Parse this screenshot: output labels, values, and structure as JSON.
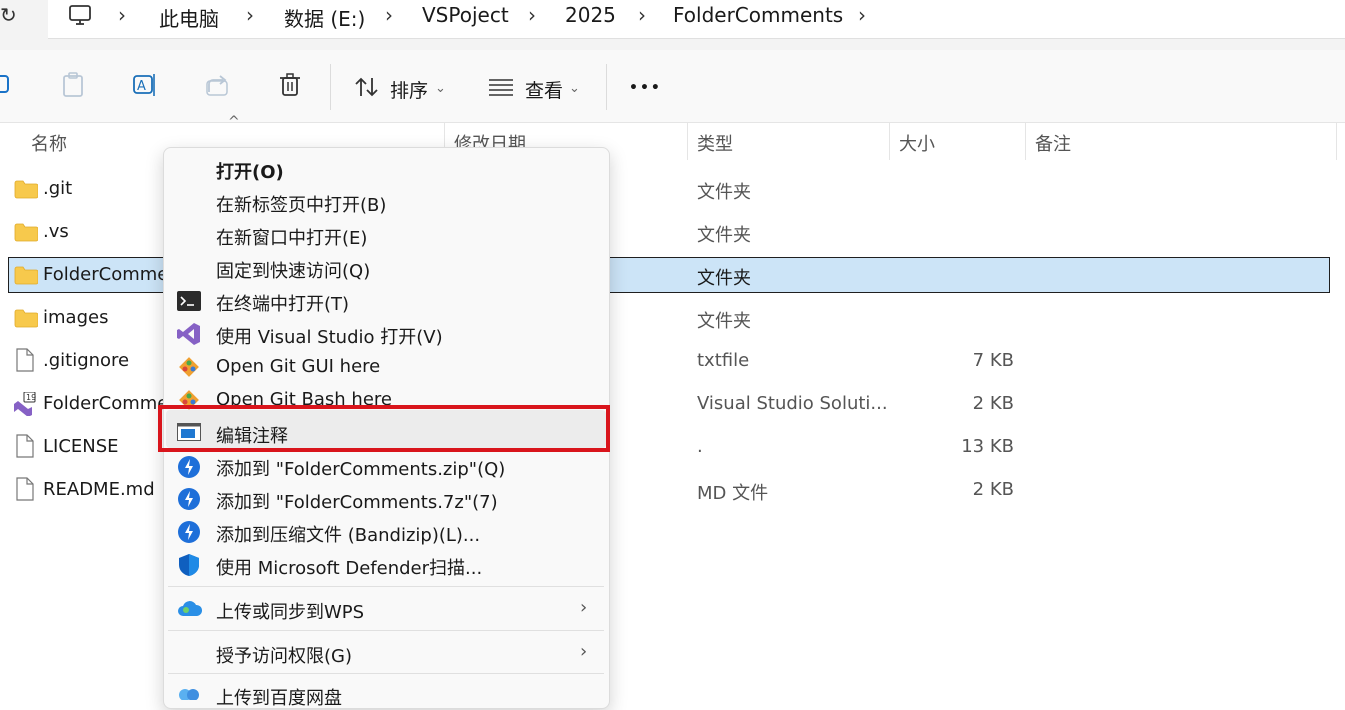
{
  "address": {
    "crumbs": [
      "此电脑",
      "数据 (E:)",
      "VSPoject",
      "2025",
      "FolderComments"
    ]
  },
  "toolbar": {
    "sort_label": "排序",
    "view_label": "查看",
    "more_label": "•••"
  },
  "columns": {
    "name": "名称",
    "date": "修改日期",
    "type": "类型",
    "size": "大小",
    "comment": "备注"
  },
  "files": [
    {
      "name": ".git",
      "type": "文件夹",
      "size": "",
      "icon": "folder-icon"
    },
    {
      "name": ".vs",
      "type": "文件夹",
      "size": "",
      "icon": "folder-icon"
    },
    {
      "name": "FolderComme",
      "type": "文件夹",
      "size": "",
      "icon": "folder-icon",
      "selected": true
    },
    {
      "name": "images",
      "type": "文件夹",
      "size": "",
      "icon": "folder-icon"
    },
    {
      "name": ".gitignore",
      "type": "txtfile",
      "size": "7 KB",
      "icon": "file-icon"
    },
    {
      "name": "FolderComme",
      "type": "Visual Studio Soluti...",
      "size": "2 KB",
      "icon": "vs-solution-icon"
    },
    {
      "name": "LICENSE",
      "type": ".",
      "size": "13 KB",
      "icon": "file-icon"
    },
    {
      "name": "README.md",
      "type": "MD 文件",
      "size": "2 KB",
      "icon": "file-icon"
    }
  ],
  "menu": {
    "items": [
      {
        "label": "打开(O)",
        "icon": ""
      },
      {
        "label": "在新标签页中打开(B)",
        "icon": ""
      },
      {
        "label": "在新窗口中打开(E)",
        "icon": ""
      },
      {
        "label": "固定到快速访问(Q)",
        "icon": ""
      },
      {
        "label": "在终端中打开(T)",
        "icon": "terminal-icon"
      },
      {
        "label": "使用 Visual Studio 打开(V)",
        "icon": "visual-studio-icon"
      },
      {
        "label": "Open Git GUI here",
        "icon": "git-icon"
      },
      {
        "label": "Open Git Bash here",
        "icon": "git-icon"
      },
      {
        "label": "编辑注释",
        "icon": "comment-window-icon"
      },
      {
        "label": "添加到 \"FolderComments.zip\"(Q)",
        "icon": "bandizip-icon"
      },
      {
        "label": "添加到 \"FolderComments.7z\"(7)",
        "icon": "bandizip-icon"
      },
      {
        "label": "添加到压缩文件 (Bandizip)(L)...",
        "icon": "bandizip-icon"
      },
      {
        "label": "使用 Microsoft Defender扫描...",
        "icon": "defender-shield-icon"
      },
      {
        "label": "上传或同步到WPS",
        "icon": "wps-cloud-icon"
      },
      {
        "label": "授予访问权限(G)",
        "icon": ""
      },
      {
        "label": "上传到百度网盘",
        "icon": "baidu-netdisk-icon"
      }
    ]
  },
  "colors": {
    "selection": "#cce4f7",
    "highlight_box": "#d9151c",
    "folder": "#f7c94c"
  }
}
